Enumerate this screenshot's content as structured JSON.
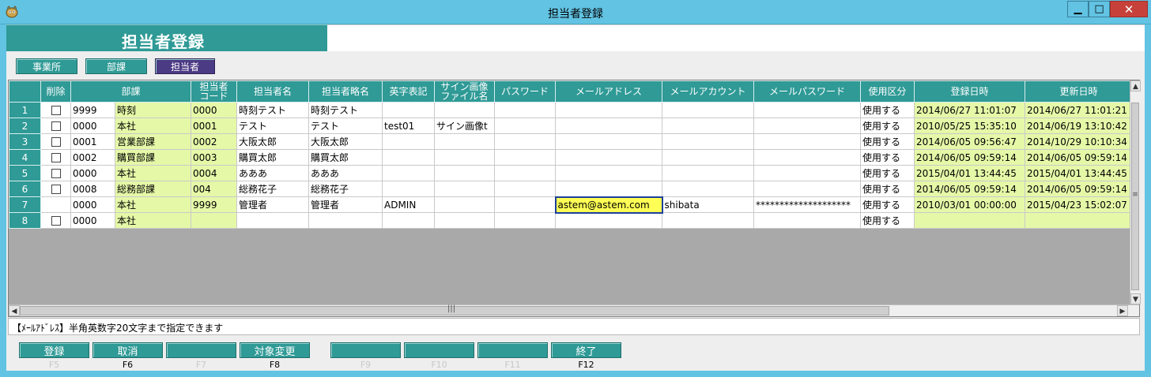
{
  "window": {
    "title": "担当者登録",
    "min_glyph": "▁",
    "max_glyph": "□",
    "close_glyph": "✕"
  },
  "banner": {
    "title": "担当者登録"
  },
  "tabs": [
    {
      "label": "事業所"
    },
    {
      "label": "部課"
    },
    {
      "label": "担当者"
    }
  ],
  "grid": {
    "columns": [
      "",
      "削除",
      "部課",
      "",
      "担当者\nコード",
      "担当者名",
      "担当者略名",
      "英字表記",
      "サイン画像\nファイル名",
      "パスワード",
      "メールアドレス",
      "メールアカウント",
      "メールパスワード",
      "使用区分",
      "登録日時",
      "更新日時"
    ],
    "rows": [
      {
        "no": "1",
        "del": true,
        "bu_code": "9999",
        "bu_name": "時刻",
        "code": "0000",
        "name": "時刻テスト",
        "short": "時刻テスト",
        "eng": "",
        "sign": "",
        "pass": "",
        "mail": "",
        "acct": "",
        "mpass": "",
        "use": "使用する",
        "reg": "2014/06/27 11:01:07",
        "upd": "2014/06/27 11:01:21"
      },
      {
        "no": "2",
        "del": true,
        "bu_code": "0000",
        "bu_name": "本社",
        "code": "0001",
        "name": "テスト",
        "short": "テスト",
        "eng": "test01",
        "sign": "サイン画像t",
        "pass": "",
        "mail": "",
        "acct": "",
        "mpass": "",
        "use": "使用する",
        "reg": "2010/05/25 15:35:10",
        "upd": "2014/06/19 13:10:42"
      },
      {
        "no": "3",
        "del": true,
        "bu_code": "0001",
        "bu_name": "営業部課",
        "code": "0002",
        "name": "大阪太郎",
        "short": "大阪太郎",
        "eng": "",
        "sign": "",
        "pass": "",
        "mail": "",
        "acct": "",
        "mpass": "",
        "use": "使用する",
        "reg": "2014/06/05 09:56:47",
        "upd": "2014/10/29 10:10:34"
      },
      {
        "no": "4",
        "del": true,
        "bu_code": "0002",
        "bu_name": "購買部課",
        "code": "0003",
        "name": "購買太郎",
        "short": "購買太郎",
        "eng": "",
        "sign": "",
        "pass": "",
        "mail": "",
        "acct": "",
        "mpass": "",
        "use": "使用する",
        "reg": "2014/06/05 09:59:14",
        "upd": "2014/06/05 09:59:14"
      },
      {
        "no": "5",
        "del": true,
        "bu_code": "0000",
        "bu_name": "本社",
        "code": "0004",
        "name": "あああ",
        "short": "あああ",
        "eng": "",
        "sign": "",
        "pass": "",
        "mail": "",
        "acct": "",
        "mpass": "",
        "use": "使用する",
        "reg": "2015/04/01 13:44:45",
        "upd": "2015/04/01 13:44:45"
      },
      {
        "no": "6",
        "del": true,
        "bu_code": "0008",
        "bu_name": "総務部課",
        "code": "004",
        "name": "総務花子",
        "short": "総務花子",
        "eng": "",
        "sign": "",
        "pass": "",
        "mail": "",
        "acct": "",
        "mpass": "",
        "use": "使用する",
        "reg": "2014/06/05 09:59:14",
        "upd": "2014/06/05 09:59:14"
      },
      {
        "no": "7",
        "del": false,
        "bu_code": "0000",
        "bu_name": "本社",
        "code": "9999",
        "name": "管理者",
        "short": "管理者",
        "eng": "ADMIN",
        "sign": "",
        "pass": "",
        "mail": "astem@astem.com",
        "acct": "shibata",
        "mpass": "********************",
        "use": "使用する",
        "reg": "2010/03/01 00:00:00",
        "upd": "2015/04/23 15:02:07"
      },
      {
        "no": "8",
        "del": true,
        "bu_code": "0000",
        "bu_name": "本社",
        "code": "",
        "name": "",
        "short": "",
        "eng": "",
        "sign": "",
        "pass": "",
        "mail": "",
        "acct": "",
        "mpass": "",
        "use": "使用する",
        "reg": "",
        "upd": ""
      }
    ]
  },
  "message": "【ﾒｰﾙｱﾄﾞﾚｽ】半角英数字20文字まで指定できます",
  "function_keys": [
    {
      "label": "登録",
      "key": "F5",
      "faint": true
    },
    {
      "label": "取消",
      "key": "F6",
      "faint": false
    },
    {
      "label": "",
      "key": "F7",
      "faint": true
    },
    {
      "label": "対象変更",
      "key": "F8",
      "faint": false
    },
    {
      "label": "",
      "key": "F9",
      "faint": true
    },
    {
      "label": "",
      "key": "F10",
      "faint": true
    },
    {
      "label": "",
      "key": "F11",
      "faint": true
    },
    {
      "label": "終了",
      "key": "F12",
      "faint": false
    }
  ],
  "colors": {
    "title_bar": "#62c3e3",
    "teal": "#2f9a96",
    "active_tab": "#4b3a84",
    "green_cell": "#e5f8a8",
    "selected_cell": "#ffff55"
  }
}
